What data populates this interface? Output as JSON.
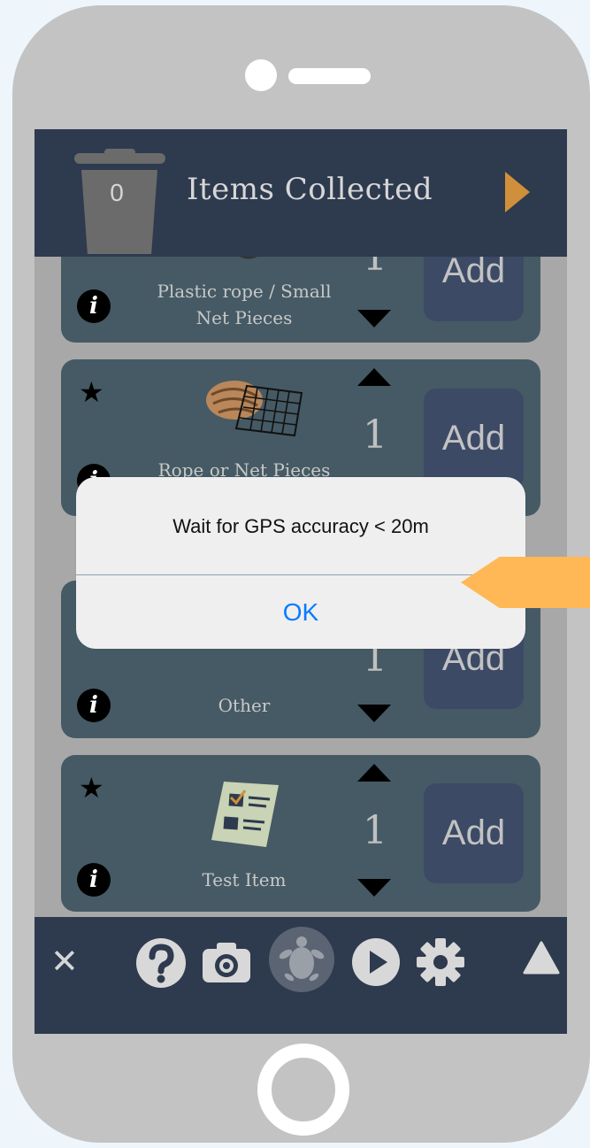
{
  "header": {
    "bin_count": "0",
    "title": "Items Collected"
  },
  "items": [
    {
      "name": "Plastic rope / Small Net Pieces",
      "qty": "1",
      "add_label": "Add"
    },
    {
      "name": "Rope or Net Pieces",
      "qty": "1",
      "add_label": "Add"
    },
    {
      "name": "Other",
      "qty": "1",
      "add_label": "Add"
    },
    {
      "name": "Test Item",
      "qty": "1",
      "add_label": "Add"
    }
  ],
  "icons": {
    "star": "★",
    "info": "i",
    "close": "✕"
  },
  "dialog": {
    "message": "Wait for GPS accuracy < 20m",
    "ok_label": "OK"
  },
  "colors": {
    "header_bg": "#2e3a4e",
    "card_bg": "#455a64",
    "add_button_bg": "#3c4a66",
    "next_arrow": "#d08f3b",
    "pointer": "#ffb855",
    "ok_text": "#0a7aff"
  }
}
